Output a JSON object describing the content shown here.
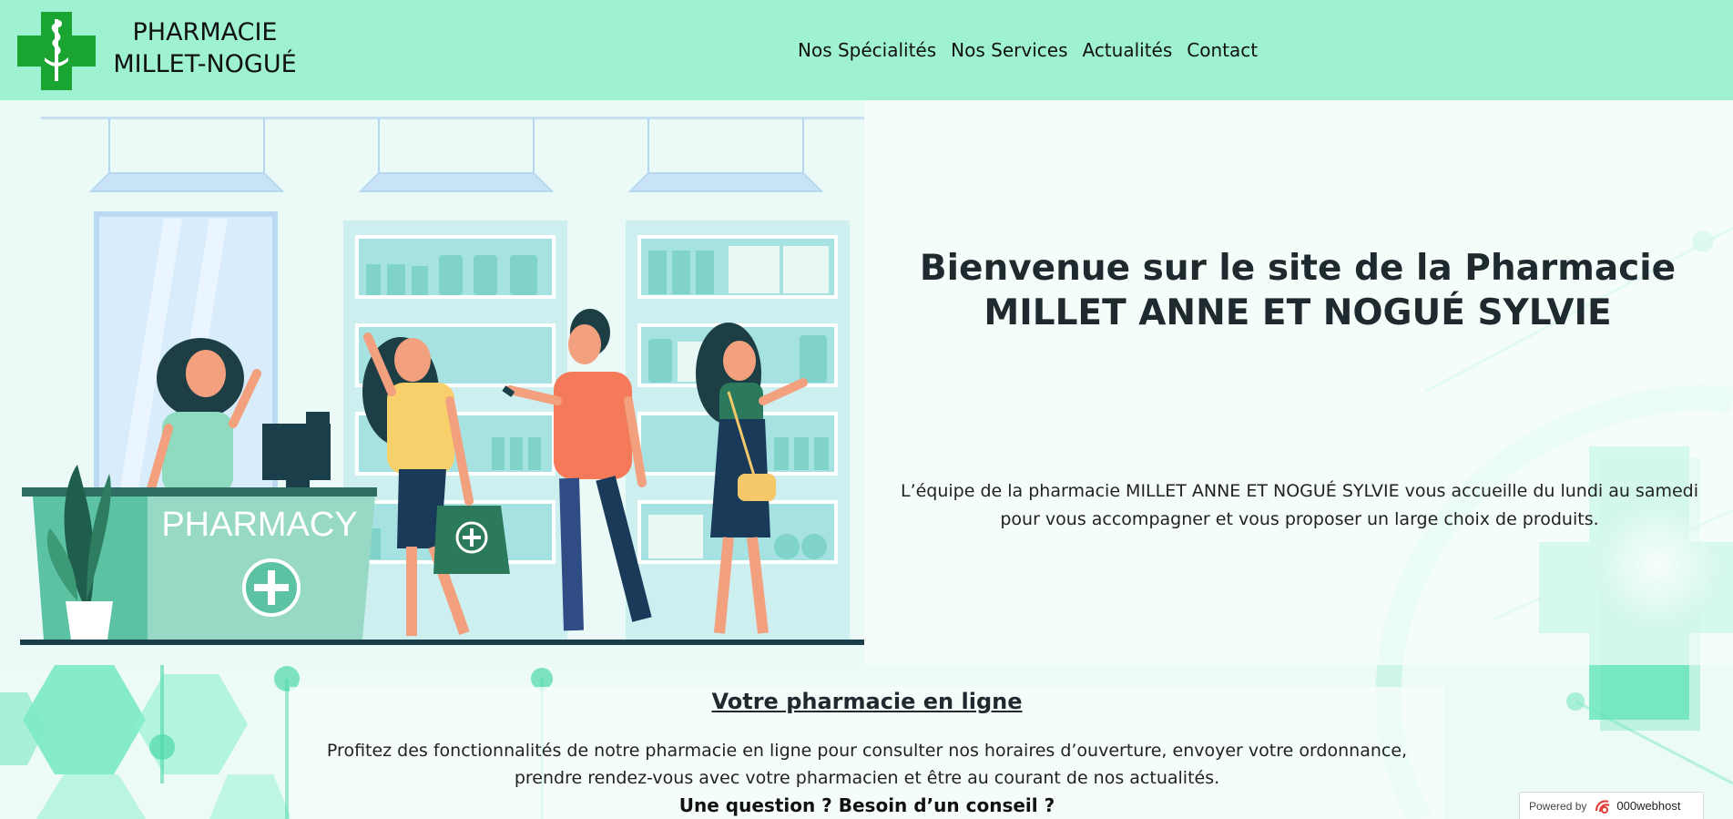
{
  "header": {
    "brand_line1": "PHARMACIE",
    "brand_line2": "MILLET-NOGUÉ",
    "logo_icon": "pharmacy-cross-caduceus-icon",
    "nav": [
      {
        "label": "Nos Spécialités"
      },
      {
        "label": "Nos Services"
      },
      {
        "label": "Actualités"
      },
      {
        "label": "Contact"
      }
    ]
  },
  "hero": {
    "illustration_sign": "PHARMACY",
    "title": "Bienvenue sur le site de la Pharmacie MILLET ANNE ET NOGUÉ SYLVIE",
    "description": "L’équipe de la pharmacie MILLET ANNE ET NOGUÉ SYLVIE vous accueille du lundi au samedi pour vous accompagner et vous proposer un large choix de produits."
  },
  "online": {
    "title": "Votre pharmacie en ligne",
    "description": "Profitez des fonctionnalités de notre pharmacie en ligne pour consulter nos horaires d’ouverture, envoyer votre ordonnance, prendre rendez-vous avec votre pharmacien et être au courant de nos actualités.",
    "cta": "Une question ? Besoin d’un conseil ?"
  },
  "badge": {
    "label": "Powered by",
    "brand": "000webhost"
  },
  "colors": {
    "header_bg": "#9ef2d2",
    "brand_green": "#1aa532",
    "mint_accent": "#5fe2b6",
    "dark_text": "#1e2a2e"
  }
}
